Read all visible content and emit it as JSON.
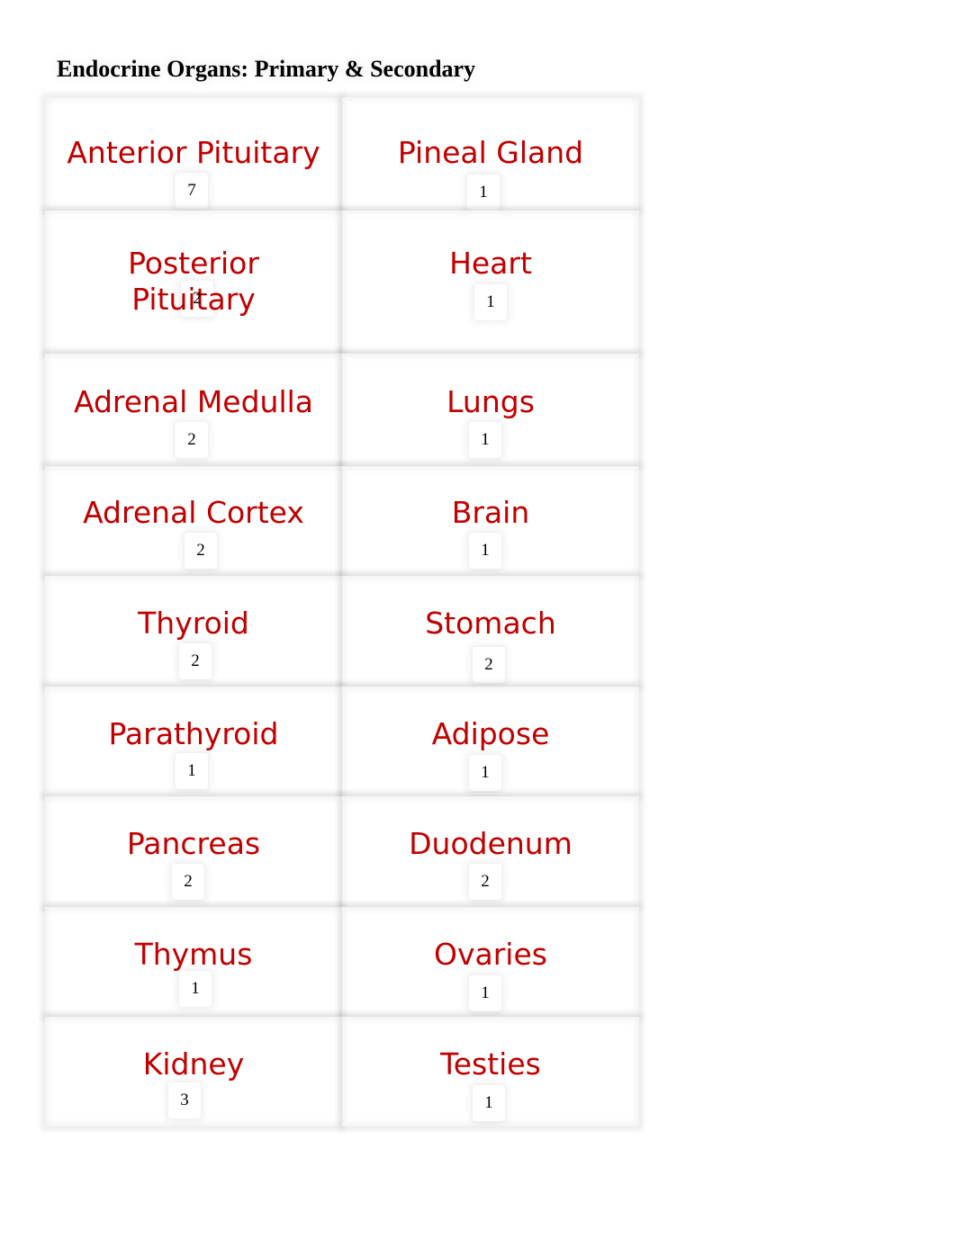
{
  "title": "Endocrine Organs: Primary & Secondary",
  "rows": [
    {
      "left": {
        "organ": "Anterior Pituitary",
        "count": "7"
      },
      "right": {
        "organ": "Pineal Gland",
        "count": "1"
      }
    },
    {
      "left": {
        "organ": "Posterior Pituitary",
        "count": "2"
      },
      "right": {
        "organ": "Heart",
        "count": "1"
      }
    },
    {
      "left": {
        "organ": "Adrenal Medulla",
        "count": "2"
      },
      "right": {
        "organ": "Lungs",
        "count": "1"
      }
    },
    {
      "left": {
        "organ": "Adrenal Cortex",
        "count": "2"
      },
      "right": {
        "organ": "Brain",
        "count": "1"
      }
    },
    {
      "left": {
        "organ": "Thyroid",
        "count": "2"
      },
      "right": {
        "organ": "Stomach",
        "count": "2"
      }
    },
    {
      "left": {
        "organ": "Parathyroid",
        "count": "1"
      },
      "right": {
        "organ": "Adipose",
        "count": "1"
      }
    },
    {
      "left": {
        "organ": "Pancreas",
        "count": "2"
      },
      "right": {
        "organ": "Duodenum",
        "count": "2"
      }
    },
    {
      "left": {
        "organ": "Thymus",
        "count": "1"
      },
      "right": {
        "organ": "Ovaries",
        "count": "1"
      }
    },
    {
      "left": {
        "organ": "Kidney",
        "count": "3"
      },
      "right": {
        "organ": "Testies",
        "count": "1"
      }
    }
  ],
  "colors": {
    "organ_text": "#c00000",
    "count_text": "#000000"
  }
}
